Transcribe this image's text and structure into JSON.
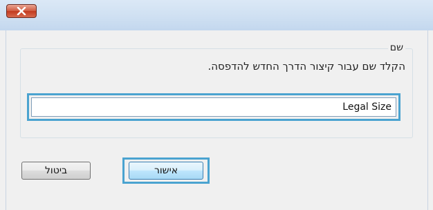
{
  "window": {
    "close_icon": "close-x-icon"
  },
  "group": {
    "label": "שם",
    "instructions": "הקלד שם עבור קיצור הדרך החדש להדפסה."
  },
  "name_field": {
    "value": "Legal Size"
  },
  "buttons": {
    "ok_label": "אישור",
    "cancel_label": "ביטול"
  }
}
